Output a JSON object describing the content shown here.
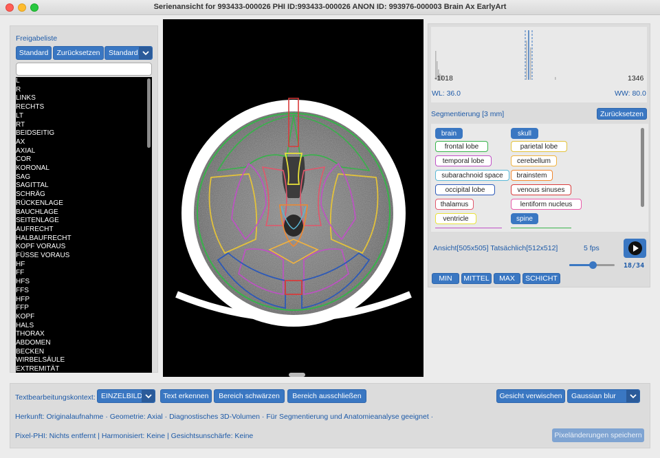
{
  "window": {
    "title": "Serienansicht for 993433-000026 PHI ID:993433-000026 ANON ID: 993976-000003 Brain Ax EarlyArt"
  },
  "release_list": {
    "label": "Freigabeliste",
    "standard_button": "Standard",
    "reset_button": "Zurücksetzen",
    "preset_select": "Standard",
    "filter_value": "",
    "items": [
      "L",
      "R",
      "LINKS",
      "RECHTS",
      "LT",
      "RT",
      "BEIDSEITIG",
      "AX",
      "AXIAL",
      "COR",
      "KORONAL",
      "SAG",
      "SAGITTAL",
      "SCHRÄG",
      "RÜCKENLAGE",
      "BAUCHLAGE",
      "SEITENLAGE",
      "AUFRECHT",
      "HALBAUFRECHT",
      "KOPF VORAUS",
      "FÜSSE VORAUS",
      "HF",
      "FF",
      "HFS",
      "FFS",
      "HFP",
      "FFP",
      "KOPF",
      "HALS",
      "THORAX",
      "ABDOMEN",
      "BECKEN",
      "WIRBELSÄULE",
      "EXTREMITÄT"
    ]
  },
  "histogram": {
    "min_label": "-1018",
    "max_label": "1346",
    "wl_label": "WL: 36.0",
    "ww_label": "WW: 80.0"
  },
  "segmentation": {
    "title": "Segmentierung [3 mm]",
    "reset_button": "Zurücksetzen",
    "chips": [
      {
        "label": "brain",
        "color": "#3a77c2",
        "filled": true
      },
      {
        "label": "skull",
        "color": "#3a77c2",
        "filled": true
      },
      {
        "label": "frontal lobe",
        "color": "#37b34a",
        "filled": false
      },
      {
        "label": "parietal lobe",
        "color": "#e3c23a",
        "filled": false
      },
      {
        "label": "temporal lobe",
        "color": "#c04fc6",
        "filled": false
      },
      {
        "label": "cerebellum",
        "color": "#f1b33e",
        "filled": false
      },
      {
        "label": "subarachnoid space",
        "color": "#5ab8d6",
        "filled": false
      },
      {
        "label": "brainstem",
        "color": "#f0872e",
        "filled": false
      },
      {
        "label": "occipital lobe",
        "color": "#2c59b8",
        "filled": false
      },
      {
        "label": "venous sinuses",
        "color": "#d93a3a",
        "filled": false
      },
      {
        "label": "thalamus",
        "color": "#e2566b",
        "filled": false
      },
      {
        "label": "lentiform nucleus",
        "color": "#e85aa8",
        "filled": false
      },
      {
        "label": "ventricle",
        "color": "#e9e23a",
        "filled": false
      },
      {
        "label": "spine",
        "color": "#3a77c2",
        "filled": true
      }
    ]
  },
  "playback": {
    "view_info": "Ansicht[505x505] Tatsächlich[512x512]",
    "fps": "5 fps",
    "frame": "18/34",
    "current_frame": 18,
    "total_frames": 34,
    "buttons": {
      "min": "MIN",
      "mid": "MITTEL",
      "max": "MAX",
      "slice": "SCHICHT"
    }
  },
  "bottom": {
    "context_label": "Textbearbeitungskontext:",
    "context_select": "EINZELBILD",
    "detect_text": "Text erkennen",
    "blacken_area": "Bereich schwärzen",
    "exclude_area": "Bereich ausschließen",
    "blur_face": "Gesicht verwischen",
    "blur_select": "Gaussian blur",
    "provenance": "Herkunft: Originalaufnahme · Geometrie: Axial · Diagnostisches 3D-Volumen · Für Segmentierung und Anatomieanalyse geeignet ·",
    "phi_status": "Pixel-PHI: Nichts entfernt | Harmonisiert: Keine | Gesichtsunschärfe: Keine",
    "save_pixels": "Pixeländerungen speichern"
  },
  "colors": {
    "accent": "#3a77c2",
    "label_text": "#1d5aa8"
  }
}
